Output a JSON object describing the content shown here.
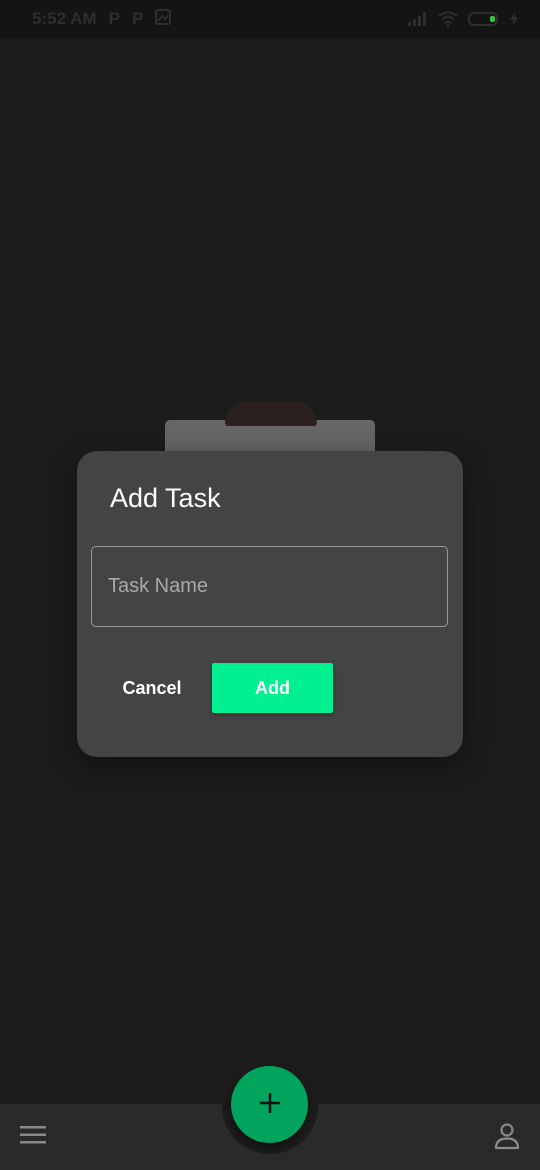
{
  "status_bar": {
    "time": "5:52 AM",
    "notification_icons": [
      "P",
      "P"
    ]
  },
  "dialog": {
    "title": "Add Task",
    "input": {
      "placeholder": "Task Name",
      "value": ""
    },
    "cancel_label": "Cancel",
    "add_label": "Add"
  },
  "bottom_nav": {
    "menu_icon": "hamburger-menu-icon",
    "fab_icon": "plus-icon",
    "profile_icon": "person-icon"
  },
  "colors": {
    "accent": "#00f08f",
    "fab": "#00a45d",
    "dialog_bg": "#444444",
    "background": "#1c1c1c"
  }
}
